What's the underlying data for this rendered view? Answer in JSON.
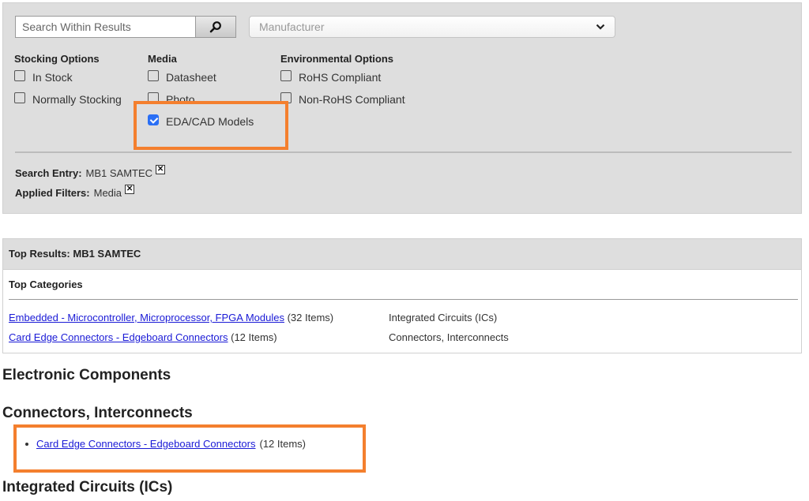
{
  "filters": {
    "search": {
      "placeholder": "Search Within Results",
      "value": ""
    },
    "search_button_icon": "magnifier-icon",
    "manufacturer": {
      "selected": "Manufacturer"
    },
    "groups": [
      {
        "title": "Stocking Options",
        "options": [
          {
            "label": "In Stock",
            "checked": false
          },
          {
            "label": "Normally Stocking",
            "checked": false
          }
        ]
      },
      {
        "title": "Media",
        "options": [
          {
            "label": "Datasheet",
            "checked": false
          },
          {
            "label": "Photo",
            "checked": false
          },
          {
            "label": "EDA/CAD Models",
            "checked": true
          }
        ]
      },
      {
        "title": "Environmental Options",
        "options": [
          {
            "label": "RoHS Compliant",
            "checked": false
          },
          {
            "label": "Non-RoHS Compliant",
            "checked": false
          }
        ]
      }
    ],
    "search_entry": {
      "label": "Search Entry:",
      "value": "MB1 SAMTEC",
      "remove_icon": "✕"
    },
    "applied_filters": {
      "label": "Applied Filters:",
      "value": "Media",
      "remove_icon": "✕"
    }
  },
  "top_results": {
    "header": "Top Results: MB1 SAMTEC",
    "categories_title": "Top Categories",
    "categories": [
      {
        "name": "Embedded - Microcontroller, Microprocessor, FPGA Modules",
        "count": "(32 Items)",
        "family": "Integrated Circuits (ICs)"
      },
      {
        "name": "Card Edge Connectors - Edgeboard Connectors",
        "count": "(12 Items)",
        "family": "Connectors, Interconnects"
      }
    ]
  },
  "sections": {
    "electronic_components": "Electronic Components",
    "connectors": {
      "title": "Connectors, Interconnects",
      "items": [
        {
          "name": "Card Edge Connectors - Edgeboard Connectors",
          "count": "(12 Items)"
        }
      ]
    },
    "ics": "Integrated Circuits (ICs)"
  },
  "colors": {
    "highlight": "#f47f2e",
    "link": "#1a1ad6",
    "checkbox_checked": "#2a6ff5",
    "panel_bg": "#dedede"
  }
}
